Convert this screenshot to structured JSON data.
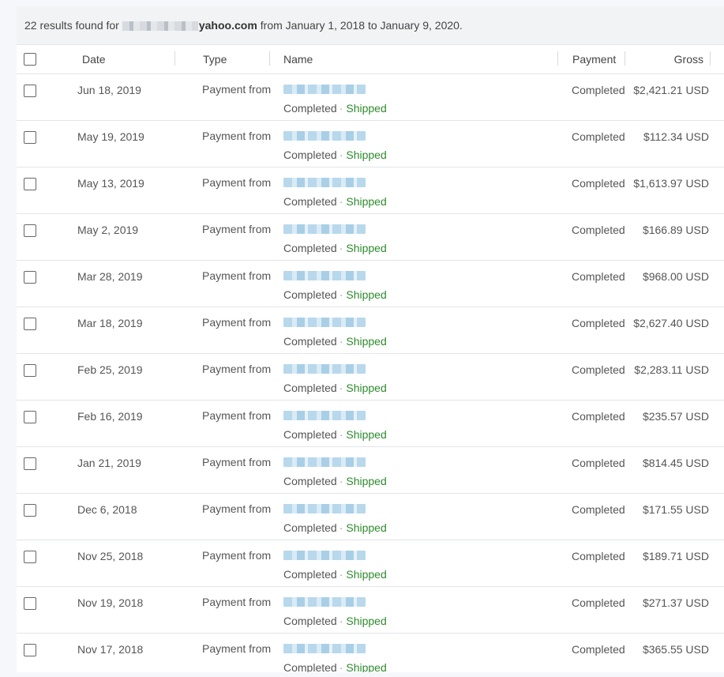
{
  "summary": {
    "prefix": "22 results found for",
    "email_domain": "yahoo.com",
    "range_text": "from January 1, 2018 to January 9, 2020."
  },
  "columns": {
    "date": "Date",
    "type": "Type",
    "name": "Name",
    "payment": "Payment",
    "gross": "Gross"
  },
  "rows": [
    {
      "date": "Jun 18, 2019",
      "type": "Payment from",
      "status": "Completed",
      "shipping": "Shipped",
      "payment": "Completed",
      "gross": "$2,421.21 USD"
    },
    {
      "date": "May 19, 2019",
      "type": "Payment from",
      "status": "Completed",
      "shipping": "Shipped",
      "payment": "Completed",
      "gross": "$112.34 USD"
    },
    {
      "date": "May 13, 2019",
      "type": "Payment from",
      "status": "Completed",
      "shipping": "Shipped",
      "payment": "Completed",
      "gross": "$1,613.97 USD"
    },
    {
      "date": "May 2, 2019",
      "type": "Payment from",
      "status": "Completed",
      "shipping": "Shipped",
      "payment": "Completed",
      "gross": "$166.89 USD"
    },
    {
      "date": "Mar 28, 2019",
      "type": "Payment from",
      "status": "Completed",
      "shipping": "Shipped",
      "payment": "Completed",
      "gross": "$968.00 USD"
    },
    {
      "date": "Mar 18, 2019",
      "type": "Payment from",
      "status": "Completed",
      "shipping": "Shipped",
      "payment": "Completed",
      "gross": "$2,627.40 USD"
    },
    {
      "date": "Feb 25, 2019",
      "type": "Payment from",
      "status": "Completed",
      "shipping": "Shipped",
      "payment": "Completed",
      "gross": "$2,283.11 USD"
    },
    {
      "date": "Feb 16, 2019",
      "type": "Payment from",
      "status": "Completed",
      "shipping": "Shipped",
      "payment": "Completed",
      "gross": "$235.57 USD"
    },
    {
      "date": "Jan 21, 2019",
      "type": "Payment from",
      "status": "Completed",
      "shipping": "Shipped",
      "payment": "Completed",
      "gross": "$814.45 USD"
    },
    {
      "date": "Dec 6, 2018",
      "type": "Payment from",
      "status": "Completed",
      "shipping": "Shipped",
      "payment": "Completed",
      "gross": "$171.55 USD"
    },
    {
      "date": "Nov 25, 2018",
      "type": "Payment from",
      "status": "Completed",
      "shipping": "Shipped",
      "payment": "Completed",
      "gross": "$189.71 USD"
    },
    {
      "date": "Nov 19, 2018",
      "type": "Payment from",
      "status": "Completed",
      "shipping": "Shipped",
      "payment": "Completed",
      "gross": "$271.37 USD"
    },
    {
      "date": "Nov 17, 2018",
      "type": "Payment from",
      "status": "Completed",
      "shipping": "Shipped",
      "payment": "Completed",
      "gross": "$365.55 USD"
    }
  ],
  "colors": {
    "shipped": "#2e8b2e",
    "header_bg": "#f2f3f4",
    "redaction_blue": "#b8d8ec"
  }
}
